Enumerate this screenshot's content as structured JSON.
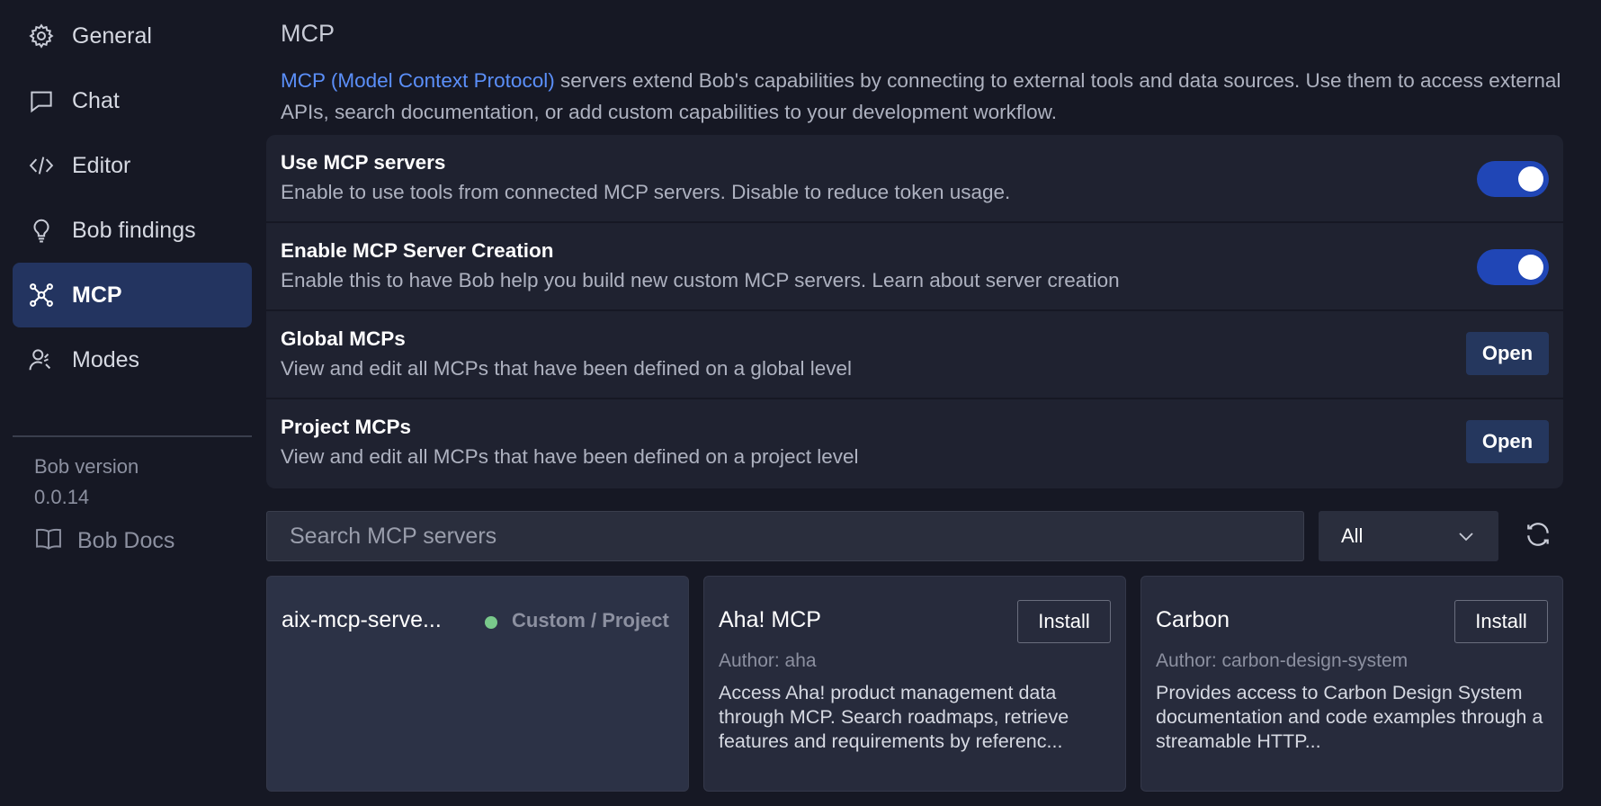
{
  "sidebar": {
    "items": [
      {
        "label": "General",
        "icon": "gear-icon"
      },
      {
        "label": "Chat",
        "icon": "chat-bubble-icon"
      },
      {
        "label": "Editor",
        "icon": "code-icon"
      },
      {
        "label": "Bob findings",
        "icon": "lightbulb-icon"
      },
      {
        "label": "MCP",
        "icon": "mcp-network-icon",
        "active": true
      },
      {
        "label": "Modes",
        "icon": "user-modes-icon"
      }
    ],
    "version_label": "Bob version",
    "version_value": "0.0.14",
    "docs_label": "Bob Docs"
  },
  "main": {
    "title": "MCP",
    "intro_link": "MCP (Model Context Protocol)",
    "intro_text": " servers extend Bob's capabilities by connecting to external tools and data sources. Use them to access external APIs, search documentation, or add custom capabilities to your development workflow.",
    "settings": [
      {
        "title": "Use MCP servers",
        "desc": "Enable to use tools from connected MCP servers. Disable to reduce token usage.",
        "control": "toggle",
        "enabled": true
      },
      {
        "title": "Enable MCP Server Creation",
        "desc": "Enable this to have Bob help you build new custom MCP servers. Learn about server creation",
        "control": "toggle",
        "enabled": true
      },
      {
        "title": "Global MCPs",
        "desc": "View and edit all MCPs that have been defined on a global level",
        "control": "button",
        "button_label": "Open"
      },
      {
        "title": "Project MCPs",
        "desc": "View and edit all MCPs that have been defined on a project level",
        "control": "button",
        "button_label": "Open"
      }
    ],
    "search": {
      "placeholder": "Search MCP servers",
      "value": ""
    },
    "filter": {
      "selected": "All"
    },
    "servers": [
      {
        "name": "aix-mcp-serve...",
        "status_color": "#79c98b",
        "scope": "Custom / Project"
      },
      {
        "name": "Aha! MCP",
        "install_label": "Install",
        "author": "Author: aha",
        "desc": "Access Aha! product management data through MCP. Search roadmaps, retrieve features and requirements by referenc..."
      },
      {
        "name": "Carbon",
        "install_label": "Install",
        "author": "Author: carbon-design-system",
        "desc": "Provides access to Carbon Design System documentation and code examples through a streamable HTTP..."
      }
    ]
  },
  "colors": {
    "accent": "#2046b6",
    "link": "#5b8ff9",
    "active_nav": "#233460",
    "status_green": "#79c98b"
  }
}
